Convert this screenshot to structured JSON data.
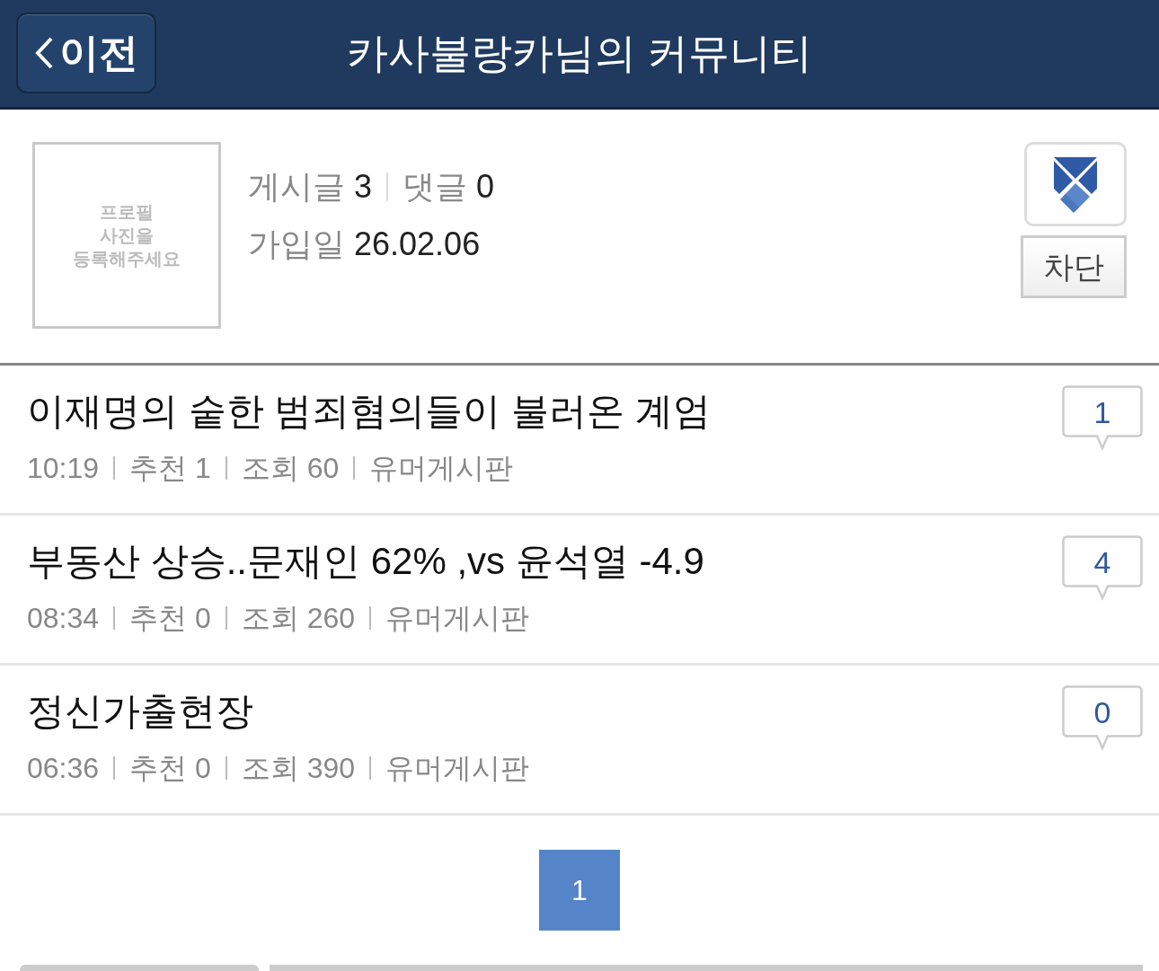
{
  "header": {
    "back_button": "이전",
    "title": "카사불랑카님의 커뮤니티"
  },
  "profile": {
    "photo_placeholder": "프로필 사진을 등록해주세요",
    "posts_label": "게시글",
    "posts": "3",
    "comments_label": "댓글",
    "comments": "0",
    "joined_label": "가입일",
    "joined": "26.02.06",
    "block_button": "차단"
  },
  "posts": [
    {
      "title": "이재명의 숱한 범죄혐의들이 불러온 계엄",
      "time": "10:19",
      "recommend": "추천 1",
      "views": "조회 60",
      "board": "유머게시판",
      "comment_count": "1"
    },
    {
      "title": "부동산 상승..문재인 62% ,vs 윤석열 -4.9",
      "time": "08:34",
      "recommend": "추천 0",
      "views": "조회 260",
      "board": "유머게시판",
      "comment_count": "4"
    },
    {
      "title": "정신가출현장",
      "time": "06:36",
      "recommend": "추천 0",
      "views": "조회 390",
      "board": "유머게시판",
      "comment_count": "0"
    }
  ],
  "pagination": [
    {
      "label": "1",
      "selected": true
    }
  ]
}
